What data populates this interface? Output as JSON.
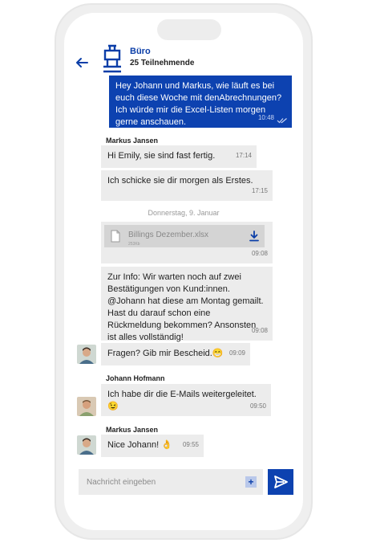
{
  "header": {
    "title": "Büro",
    "subtitle": "25 Teilnehmende"
  },
  "messages": {
    "outgoing": {
      "text": "Hey Johann und Markus, wie läuft es bei euch diese Woche mit denAbrechnungen? Ich würde mir die Excel-Listen morgen gerne anschauen.",
      "time": "10:48"
    },
    "markus1": {
      "sender": "Markus Jansen",
      "text": "Hi Emily, sie sind fast fertig.",
      "time": "17:14"
    },
    "markus2": {
      "text": "Ich schicke sie dir morgen als Erstes.",
      "time": "17:15"
    },
    "date_separator": "Donnerstag, 9. Januar",
    "file": {
      "name": "Billings Dezember.xlsx",
      "size": "253Kb",
      "time": "09:08"
    },
    "info": {
      "text": "Zur Info: Wir warten noch auf zwei Bestätigungen von Kund:innen. @Johann hat diese am Montag gemailt. Hast du darauf schon eine Rückmeldung bekommen? Ansonsten ist alles vollständig!",
      "time": "09:08"
    },
    "fragen": {
      "text": "Fragen? Gib mir Bescheid.😁",
      "time": "09:09"
    },
    "johann": {
      "sender": "Johann Hofmann",
      "text": "Ich habe dir die E-Mails weitergeleitet. 😉",
      "time": "09:50"
    },
    "markus3": {
      "sender": "Markus Jansen",
      "text": "Nice Johann! 👌",
      "time": "09:55"
    }
  },
  "composer": {
    "placeholder": "Nachricht eingeben"
  },
  "colors": {
    "accent": "#0d42b0",
    "bubble": "#ececec"
  }
}
